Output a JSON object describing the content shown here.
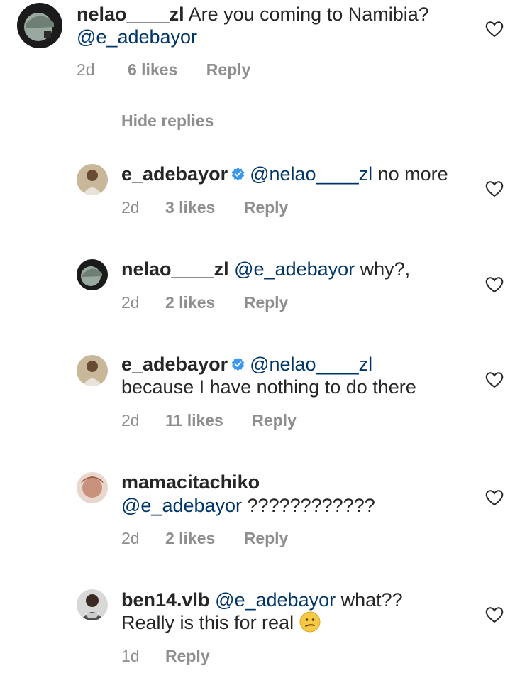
{
  "colors": {
    "text": "#262626",
    "muted": "#8e8e8e",
    "mention": "#003569",
    "verified": "#3897f0"
  },
  "comments": [
    {
      "user": "nelao____zl",
      "text": " Are you coming to Namibia?",
      "mention_line2": "@e_adebayor",
      "meta": {
        "time": "2d",
        "likes": "6 likes",
        "reply": "Reply"
      },
      "avatar_icon": "cartoon-avatar-icon"
    },
    {
      "user": "e_adebayor",
      "verified_icon": "verified-badge-icon",
      "mention": "@nelao____zl",
      "text": " no more",
      "meta": {
        "time": "2d",
        "likes": "3 likes",
        "reply": "Reply"
      }
    },
    {
      "user": "nelao____zl",
      "mention": "@e_adebayor",
      "text": "  why?,",
      "meta": {
        "time": "2d",
        "likes": "2 likes",
        "reply": "Reply"
      }
    },
    {
      "user": "e_adebayor",
      "mention": "@nelao____zl",
      "text_line2": "because I have nothing to do there",
      "meta": {
        "time": "2d",
        "likes": "11 likes",
        "reply": "Reply"
      }
    },
    {
      "user": "mamacitachiko",
      "mention": "@e_adebayor",
      "text": " ????????????",
      "meta": {
        "time": "2d",
        "likes": "2 likes",
        "reply": "Reply"
      }
    },
    {
      "user": "ben14.vlb",
      "mention": "@e_adebayor",
      "text": " what??",
      "text_line2": "Really is this for real",
      "emoji_icon": "confused-face-emoji",
      "meta": {
        "time": "1d",
        "reply": "Reply"
      }
    }
  ],
  "hide_replies": "Hide replies",
  "heart_icon": "heart-icon"
}
